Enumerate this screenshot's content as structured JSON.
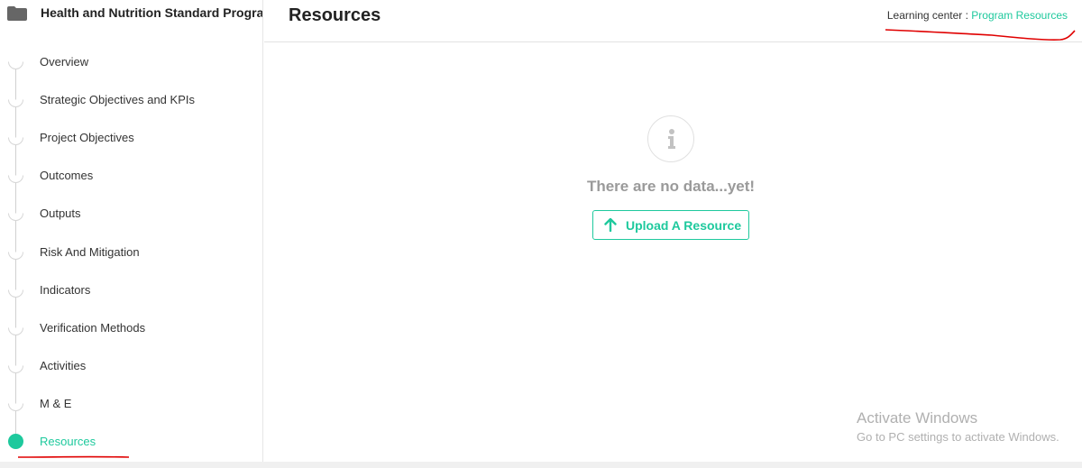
{
  "sidebar": {
    "program_title": "Health and Nutrition Standard Program",
    "folder_icon": "folder-icon",
    "items": [
      {
        "label": "Overview",
        "active": false
      },
      {
        "label": "Strategic Objectives and KPIs",
        "active": false
      },
      {
        "label": "Project Objectives",
        "active": false
      },
      {
        "label": "Outcomes",
        "active": false
      },
      {
        "label": "Outputs",
        "active": false
      },
      {
        "label": "Risk And Mitigation",
        "active": false
      },
      {
        "label": "Indicators",
        "active": false
      },
      {
        "label": "Verification Methods",
        "active": false
      },
      {
        "label": "Activities",
        "active": false
      },
      {
        "label": "M & E",
        "active": false
      },
      {
        "label": "Resources",
        "active": true
      }
    ]
  },
  "header": {
    "title": "Resources",
    "breadcrumb_prefix": "Learning center : ",
    "breadcrumb_link": "Program Resources"
  },
  "main": {
    "empty_icon": "info-icon",
    "empty_text": "There are no data...yet!",
    "upload_label": "Upload A Resource",
    "upload_icon": "arrow-up-icon"
  },
  "watermark": {
    "title": "Activate Windows",
    "subtitle": "Go to PC settings to activate Windows."
  },
  "colors": {
    "accent": "#1ec99d",
    "annotation": "#e00000"
  }
}
